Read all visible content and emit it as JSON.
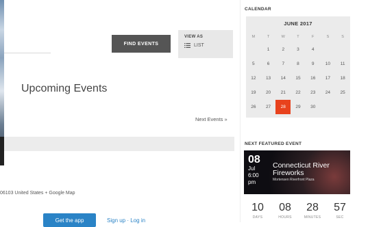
{
  "search": {
    "find_button_label": "FIND EVENTS"
  },
  "view_as": {
    "title": "VIEW AS",
    "option_label": "LIST",
    "option_icon": "list-icon"
  },
  "main": {
    "heading": "Upcoming Events",
    "next_link": "Next Events »",
    "address_text": "06103 United States + Google Map",
    "cta_label": "Get the app",
    "signup_text": "Sign up · Log in"
  },
  "sidebar": {
    "calendar_heading": "CALENDAR",
    "calendar": {
      "month": "JUNE 2017",
      "weekdays": [
        "M",
        "T",
        "W",
        "T",
        "F",
        "S",
        "S"
      ],
      "weeks": [
        [
          "",
          "1",
          "2",
          "3",
          "4",
          "",
          ""
        ],
        [
          "5",
          "6",
          "7",
          "8",
          "9",
          "10",
          "11"
        ],
        [
          "12",
          "13",
          "14",
          "15",
          "16",
          "17",
          "18"
        ],
        [
          "19",
          "20",
          "21",
          "22",
          "23",
          "24",
          "25"
        ],
        [
          "26",
          "27",
          "28",
          "29",
          "30",
          "",
          ""
        ]
      ],
      "today": "28",
      "accent": "#e8421d"
    },
    "featured_heading": "NEXT FEATURED EVENT",
    "featured": {
      "day": "08",
      "month": "Jul",
      "time": "6:00",
      "ampm": "pm",
      "title": "Connecticut River Fireworks",
      "venue": "Mortensen Riverfront Plaza"
    },
    "countdown": [
      {
        "value": "10",
        "label": "DAYS"
      },
      {
        "value": "08",
        "label": "HOURS"
      },
      {
        "value": "28",
        "label": "MINUTES"
      },
      {
        "value": "57",
        "label": "SEC"
      }
    ]
  },
  "colors": {
    "button_dark": "#555555",
    "link_blue": "#2a83c6",
    "today_red": "#e8421d"
  }
}
